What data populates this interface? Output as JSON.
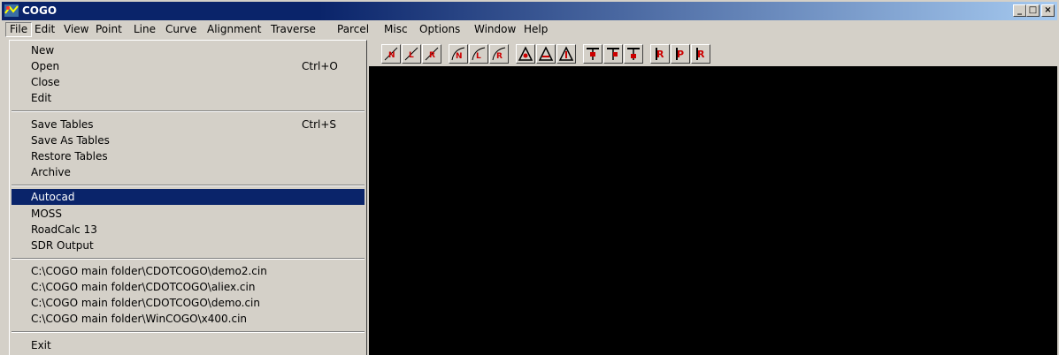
{
  "window": {
    "title": "COGO",
    "controls": {
      "minimize": "_",
      "maximize": "□",
      "close": "×"
    }
  },
  "menubar": {
    "items": [
      "File",
      "Edit",
      "View",
      "Point",
      "Line",
      "Curve",
      "Alignment",
      "Traverse",
      "Parcel",
      "Misc",
      "Options",
      "Window",
      "Help"
    ],
    "active": "File"
  },
  "file_menu": {
    "groups": [
      [
        {
          "label": "New",
          "shortcut": ""
        },
        {
          "label": "Open",
          "shortcut": "Ctrl+O"
        },
        {
          "label": "Close",
          "shortcut": ""
        },
        {
          "label": "Edit",
          "shortcut": ""
        }
      ],
      [
        {
          "label": "Save Tables",
          "shortcut": "Ctrl+S"
        },
        {
          "label": "Save As Tables",
          "shortcut": ""
        },
        {
          "label": "Restore Tables",
          "shortcut": ""
        },
        {
          "label": "Archive",
          "shortcut": ""
        }
      ],
      [
        {
          "label": "Autocad",
          "shortcut": ""
        },
        {
          "label": "MOSS",
          "shortcut": ""
        },
        {
          "label": "RoadCalc 13",
          "shortcut": ""
        },
        {
          "label": "SDR Output",
          "shortcut": ""
        }
      ],
      [
        {
          "label": "C:\\COGO main folder\\CDOTCOGO\\demo2.cin",
          "shortcut": ""
        },
        {
          "label": "C:\\COGO main folder\\CDOTCOGO\\aliex.cin",
          "shortcut": ""
        },
        {
          "label": "C:\\COGO main folder\\CDOTCOGO\\demo.cin",
          "shortcut": ""
        },
        {
          "label": "C:\\COGO main folder\\WinCOGO\\x400.cin",
          "shortcut": ""
        }
      ],
      [
        {
          "label": "Exit",
          "shortcut": ""
        }
      ]
    ],
    "highlighted": "Autocad"
  },
  "toolbar": {
    "groups": [
      [
        "line-n-icon",
        "line-l-icon",
        "line-r-icon"
      ],
      [
        "curve-n-icon",
        "curve-l-icon",
        "curve-r-icon"
      ],
      [
        "triangle-1-icon",
        "triangle-2-icon",
        "triangle-3-icon"
      ],
      [
        "tee-1-icon",
        "tee-2-icon",
        "tee-3-icon"
      ],
      [
        "flag-r-icon",
        "flag-p-icon",
        "flag-r2-icon"
      ]
    ],
    "icon_color": "#cc0000"
  },
  "colors": {
    "title_start": "#0a246a",
    "title_end": "#a6caf0",
    "highlight": "#0a246a",
    "canvas": "#000000",
    "face": "#d4d0c8"
  }
}
